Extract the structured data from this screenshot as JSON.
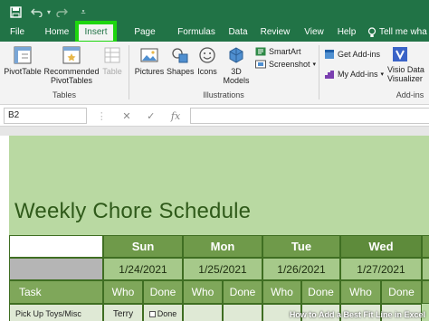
{
  "colors": {
    "excel_green": "#217346",
    "insert_highlight": "#1ed60f",
    "sheet_bg": "#b9d9a2",
    "header_green": "#6f9a4a"
  },
  "titlebar": {
    "save_icon": "save-icon",
    "undo_icon": "undo-icon",
    "redo_icon": "redo-icon",
    "customize_icon": "dropdown-icon"
  },
  "tabs": [
    "File",
    "Home",
    "Insert",
    "Page Layout",
    "Formulas",
    "Data",
    "Review",
    "View",
    "Help",
    "Tell me wha"
  ],
  "ribbon": {
    "pivot_table": "PivotTable",
    "recommended_pivot": "Recommended PivotTables",
    "table": "Table",
    "tables_group": "Tables",
    "pictures": "Pictures",
    "shapes": "Shapes",
    "icons": "Icons",
    "models_3d": "3D Models",
    "smartart": "SmartArt",
    "screenshot": "Screenshot",
    "illustrations_group": "Illustrations",
    "get_addins": "Get Add-ins",
    "my_addins": "My Add-ins",
    "visio": "Visio Data Visualizer",
    "addins_group": "Add-ins"
  },
  "formula_bar": {
    "name_box": "B2",
    "cancel": "✕",
    "enter": "✓",
    "fx": "fx",
    "formula": ""
  },
  "sheet": {
    "title": "Weekly Chore Schedule",
    "days": [
      "Sun",
      "Mon",
      "Tue",
      "Wed"
    ],
    "dates": [
      "1/24/2021",
      "1/25/2021",
      "1/26/2021",
      "1/27/2021"
    ],
    "task_label": "Task",
    "who_label": "Who",
    "done_label": "Done",
    "first_task": "Pick Up Toys/Misc",
    "first_who": "Terry",
    "first_done": "Done"
  },
  "watermark": "How to Add a Best Fit Line in Excel"
}
